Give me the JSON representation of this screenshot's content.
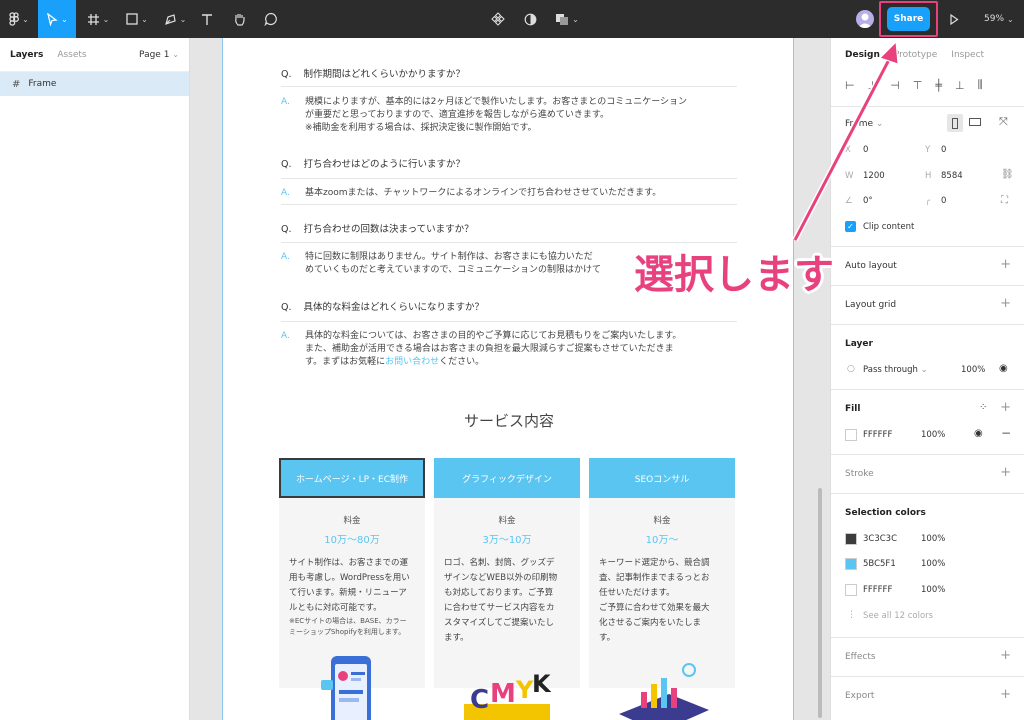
{
  "toolbar": {
    "share_label": "Share",
    "zoom": "59%"
  },
  "left_panel": {
    "tab_layers": "Layers",
    "tab_assets": "Assets",
    "page": "Page 1",
    "layer_name": "Frame"
  },
  "canvas": {
    "faq": [
      {
        "q_mark": "Q.",
        "q": "制作期間はどれくらいかかりますか？",
        "a_mark": "A.",
        "a": "規模によりますが、基本的には2ヶ月ほどで製作いたします。お客さまとのコミュニケーション\nが重要だと思っておりますので、適宜進捗を報告しながら進めていきます。\n※補助金を利用する場合は、採択決定後に製作開始です。"
      },
      {
        "q_mark": "Q.",
        "q": "打ち合わせはどのように行いますか？",
        "a_mark": "A.",
        "a": "基本zoomまたは、チャットワークによるオンラインで打ち合わせさせていただきます。"
      },
      {
        "q_mark": "Q.",
        "q": "打ち合わせの回数は決まっていますか？",
        "a_mark": "A.",
        "a": "特に回数に制限はありません。サイト制作は、お客さまにも協力いただ\nめていくものだと考えていますので、コミュニケーションの制限はかけて"
      },
      {
        "q_mark": "Q.",
        "q": "具体的な料金はどれくらいになりますか？",
        "a_mark": "A.",
        "a": "具体的な料金については、お客さまの目的やご予算に応じてお見積もりをご案内いたします。\nまた、補助金が活用できる場合はお客さまの負担を最大限減らすご提案もさせていただきま\nす。まずはお気軽に",
        "a_link": "お問い合わせ",
        "a_tail": "ください。"
      }
    ],
    "service_title": "サービス内容",
    "cards": [
      {
        "header": "ホームページ・LP・EC制作",
        "fee_label": "料金",
        "price": "10万〜80万",
        "desc": "サイト制作は、お客さまでの運\n用も考慮し。WordPressを用い\nて行います。新規・リニューア\nルともに対応可能です。",
        "note": "※ECサイトの場合は、BASE、カラー\nミーショップShopifyを利用します。"
      },
      {
        "header": "グラフィックデザイン",
        "fee_label": "料金",
        "price": "3万〜10万",
        "desc": "ロゴ、名刺、封筒、グッズデ\nザインなどWEB以外の印刷物\nも対応しております。ご予算\nに合わせてサービス内容をカ\nスタマイズしてご提案いたし\nます。",
        "note": ""
      },
      {
        "header": "SEOコンサル",
        "fee_label": "料金",
        "price": "10万〜",
        "desc": "キーワード選定から、競合調\n査、記事制作までまるっとお\n任せいただけます。\nご予算に合わせて効果を最大\n化させるご案内をいたしま\nす。",
        "note": ""
      }
    ]
  },
  "right_panel": {
    "tab_design": "Design",
    "tab_prototype": "Prototype",
    "tab_inspect": "Inspect",
    "frame_label": "Frame",
    "x_label": "X",
    "x": "0",
    "y_label": "Y",
    "y": "0",
    "w_label": "W",
    "w": "1200",
    "h_label": "H",
    "h": "8584",
    "rotation": "0°",
    "radius": "0",
    "clip_content": "Clip content",
    "auto_layout": "Auto layout",
    "layout_grid": "Layout grid",
    "layer_title": "Layer",
    "blend_mode": "Pass through",
    "layer_opacity": "100%",
    "fill_title": "Fill",
    "fill_hex": "FFFFFF",
    "fill_opacity": "100%",
    "stroke_title": "Stroke",
    "selection_colors_title": "Selection colors",
    "selection_colors": [
      {
        "hex": "3C3C3C",
        "opacity": "100%",
        "color": "#3c3c3c"
      },
      {
        "hex": "5BC5F1",
        "opacity": "100%",
        "color": "#5bc5f1"
      },
      {
        "hex": "FFFFFF",
        "opacity": "100%",
        "color": "#ffffff"
      }
    ],
    "see_all": "See all 12 colors",
    "effects": "Effects",
    "export": "Export"
  },
  "annotation": {
    "callout_text": "選択します",
    "color": "#e8427e"
  },
  "colors": {
    "accent": "#18a0fb",
    "brand_blue": "#5bc5f1",
    "toolbar_bg": "#2c2c2c"
  }
}
